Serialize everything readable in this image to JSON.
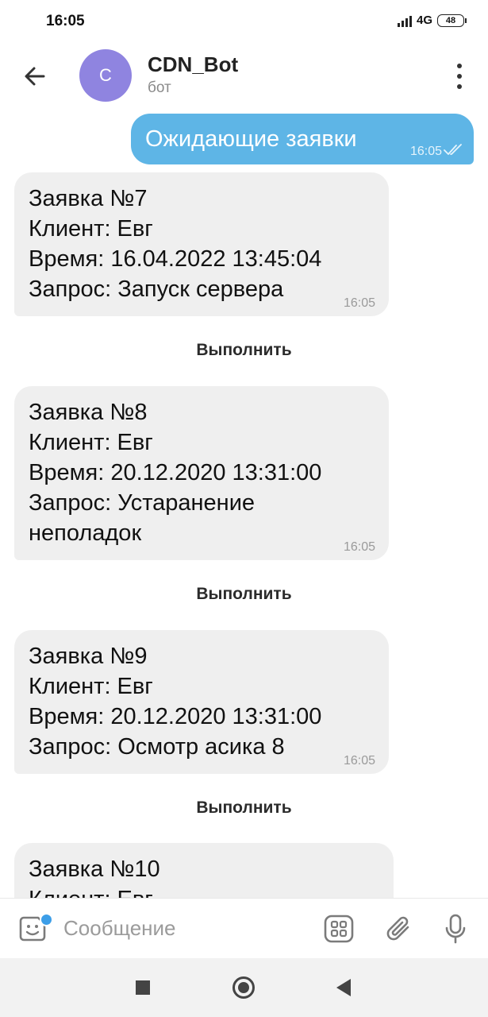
{
  "status_bar": {
    "time": "16:05",
    "network": "4G",
    "battery": "48"
  },
  "header": {
    "avatar_letter": "C",
    "title": "CDN_Bot",
    "subtitle": "бот"
  },
  "outgoing": {
    "text": "Ожидающие заявки",
    "time": "16:05"
  },
  "requests": [
    {
      "lines": [
        "Заявка №7",
        "Клиент: Евг",
        "Время: 16.04.2022 13:45:04",
        "Запрос: Запуск сервера"
      ],
      "time": "16:05",
      "action": "Выполнить"
    },
    {
      "lines": [
        "Заявка №8",
        "Клиент: Евг",
        "Время: 20.12.2020 13:31:00",
        "Запрос: Устаранение",
        "неполадок"
      ],
      "time": "16:05",
      "action": "Выполнить"
    },
    {
      "lines": [
        "Заявка №9",
        "Клиент: Евг",
        "Время: 20.12.2020 13:31:00",
        "Запрос: Осмотр асика 8"
      ],
      "time": "16:05",
      "action": "Выполнить"
    },
    {
      "lines": [
        "Заявка №10",
        "Клиент: Евг"
      ]
    }
  ],
  "composer": {
    "placeholder": "Сообщение"
  },
  "colors": {
    "accent": "#5eb5e6",
    "avatar": "#8f84e0",
    "incoming_bubble": "#efefef"
  }
}
